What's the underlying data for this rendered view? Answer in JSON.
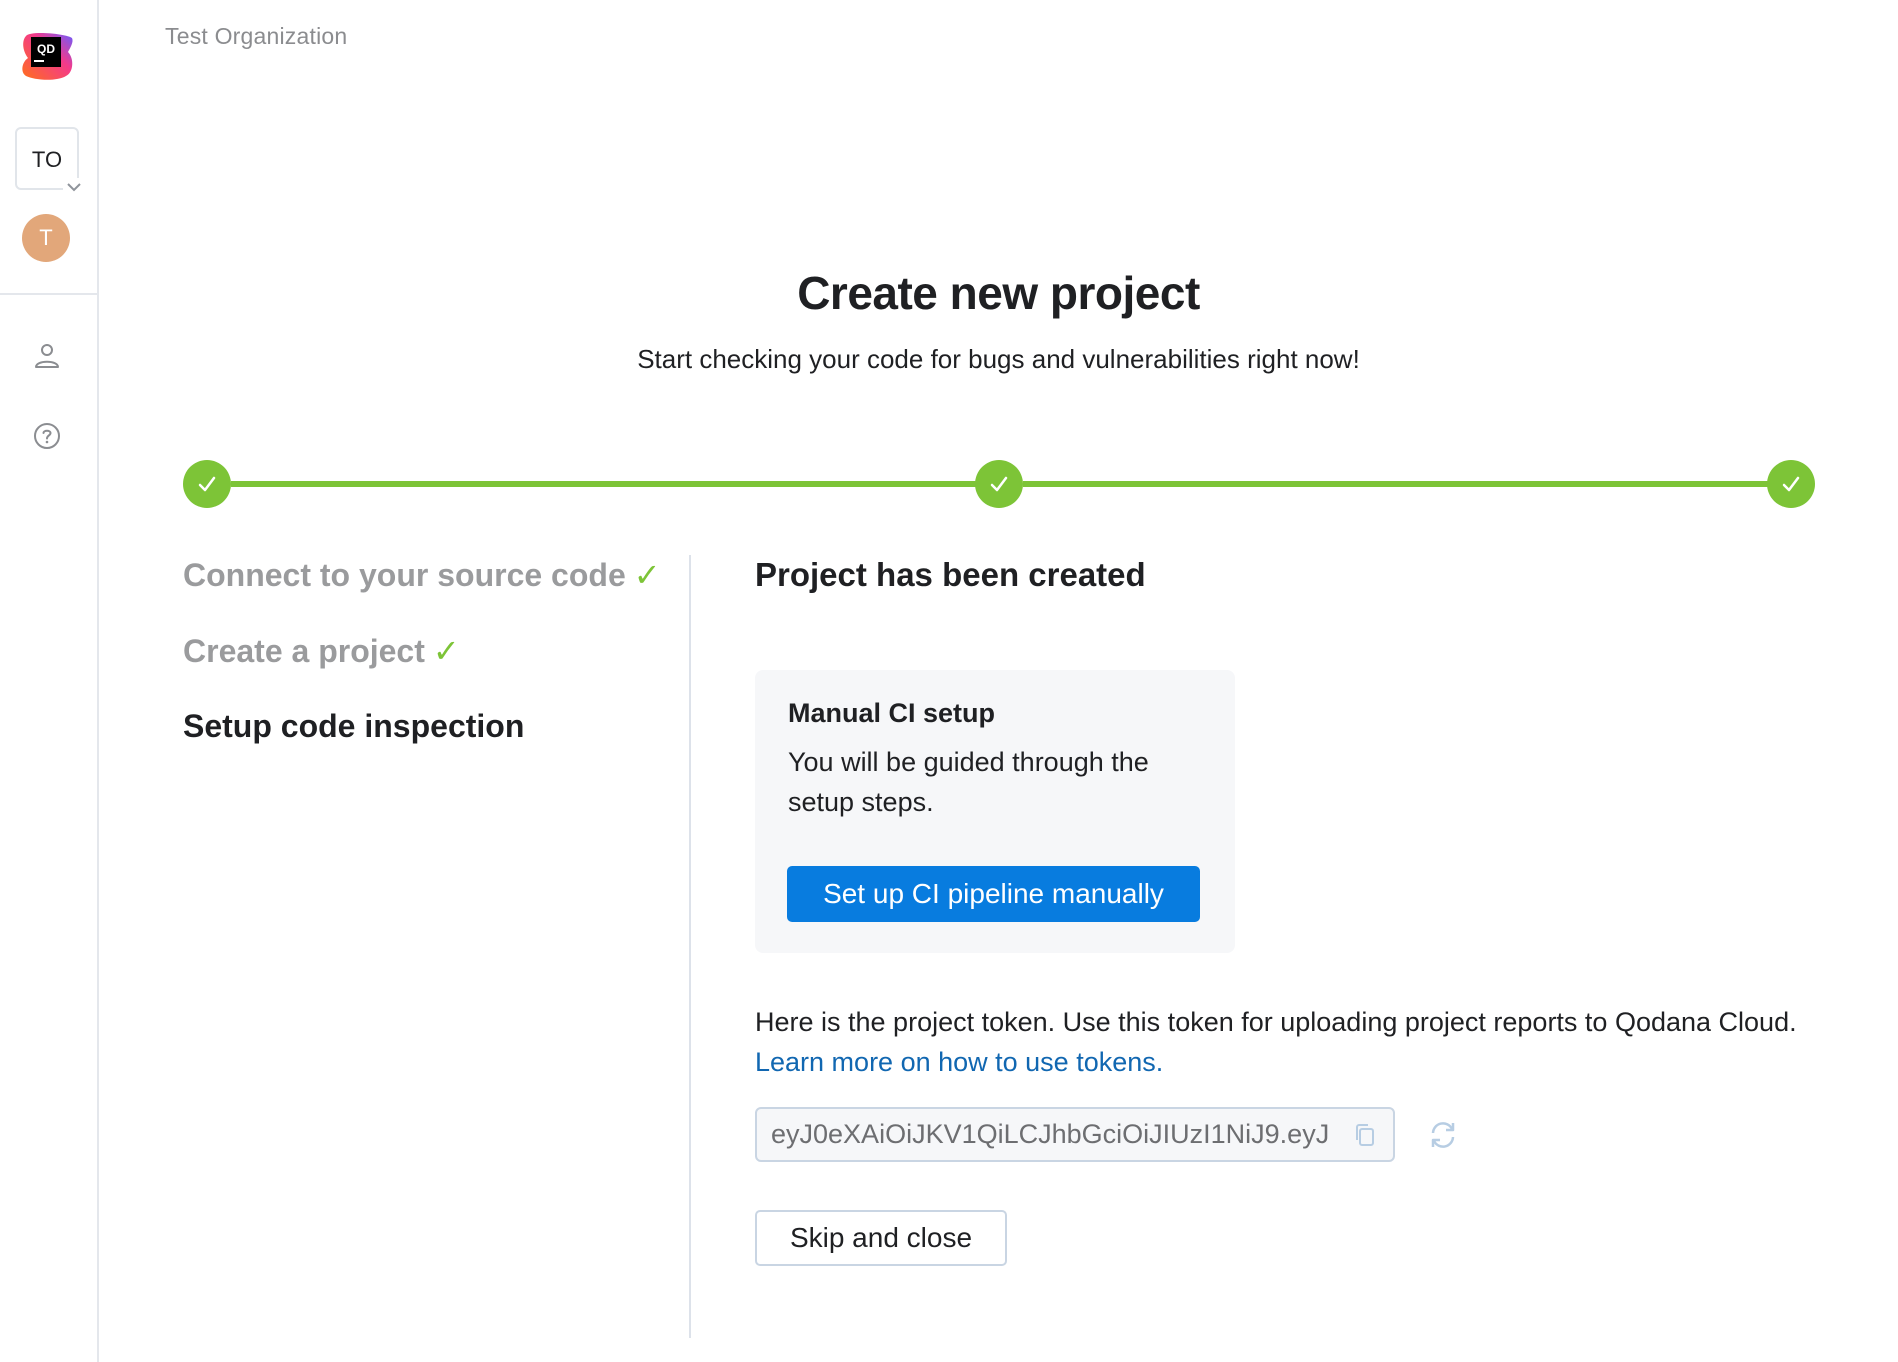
{
  "sidebar": {
    "logo_text": "QD",
    "org_initials": "TO",
    "avatar_initial": "T",
    "avatar_color": "#e2a77a",
    "icons": [
      "user-icon",
      "help-icon"
    ]
  },
  "header": {
    "org_name": "Test Organization",
    "title": "Create new project",
    "subtitle": "Start checking your code for bugs and vulnerabilities right now!"
  },
  "stepper": {
    "completed_color": "#7dc437",
    "total_steps": 3,
    "completed_steps": 3,
    "steps": [
      {
        "label": "Connect to your source code",
        "status": "done",
        "tick": "✓"
      },
      {
        "label": "Create a project",
        "status": "done",
        "tick": "✓"
      },
      {
        "label": "Setup code inspection",
        "status": "current",
        "tick": ""
      }
    ]
  },
  "main": {
    "section_title": "Project has been created",
    "card": {
      "title": "Manual CI setup",
      "description": "You will be guided through the setup steps.",
      "button_label": "Set up CI pipeline manually"
    },
    "token": {
      "text": "Here is the project token. Use this token for uploading project reports to Qodana Cloud.",
      "link_label": "Learn more on how to use tokens.",
      "value": "eyJ0eXAiOiJKV1QiLCJhbGciOiJIUzI1NiJ9.eyJ"
    },
    "skip_label": "Skip and close"
  },
  "colors": {
    "primary": "#087cdf",
    "success": "#7dc437",
    "link": "#1167b1"
  }
}
